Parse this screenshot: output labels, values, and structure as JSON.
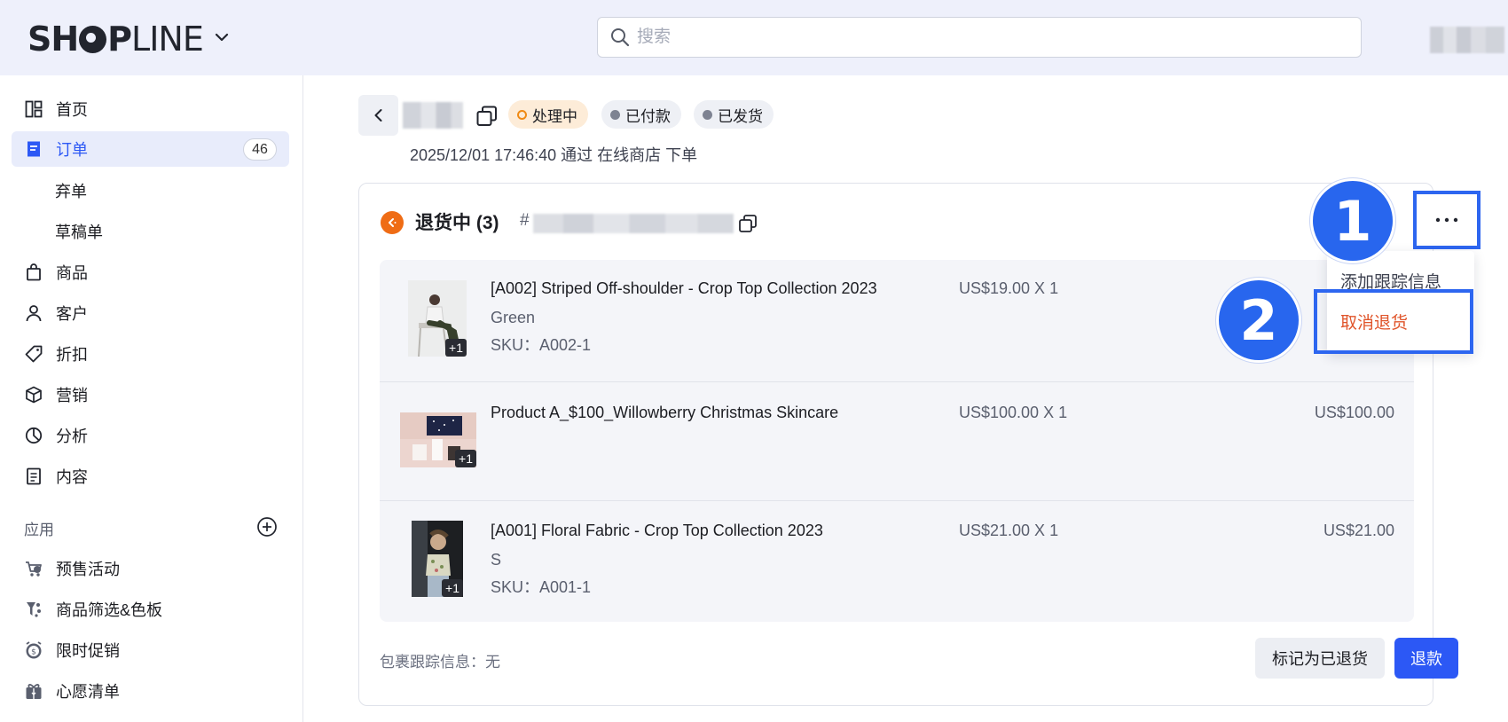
{
  "header": {
    "logo_text_1": "SH",
    "logo_text_2": "P",
    "logo_text_3": "LINE",
    "search_placeholder": "搜索"
  },
  "sidebar": {
    "items": [
      {
        "label": "首页",
        "icon": "dashboard-icon"
      },
      {
        "label": "订单",
        "icon": "orders-icon",
        "badge": "46",
        "active": true
      },
      {
        "label": "弃单",
        "sub": true
      },
      {
        "label": "草稿单",
        "sub": true
      },
      {
        "label": "商品",
        "icon": "shopping-bag-icon"
      },
      {
        "label": "客户",
        "icon": "user-icon"
      },
      {
        "label": "折扣",
        "icon": "tag-icon"
      },
      {
        "label": "营销",
        "icon": "box-icon"
      },
      {
        "label": "分析",
        "icon": "pie-chart-icon"
      },
      {
        "label": "内容",
        "icon": "document-icon"
      }
    ],
    "apps_label": "应用",
    "apps": [
      {
        "label": "预售活动",
        "icon": "presale-icon"
      },
      {
        "label": "商品筛选&色板",
        "icon": "filter-icon"
      },
      {
        "label": "限时促销",
        "icon": "timer-icon"
      },
      {
        "label": "心愿清单",
        "icon": "gift-icon"
      }
    ]
  },
  "order": {
    "tags": [
      "处理中",
      "已付款",
      "已发货"
    ],
    "meta": "2025/12/01 17:46:40 通过 在线商店 下单"
  },
  "card": {
    "title": "退货中 (3)",
    "hash_prefix": "#",
    "items": [
      {
        "name": "[A002] Striped Off-shoulder - Crop Top Collection 2023",
        "variant": "Green",
        "sku": "SKU：A002-1",
        "price": "US$19.00 X 1",
        "total": "",
        "plus": "+1"
      },
      {
        "name": "Product A_$100_Willowberry Christmas Skincare",
        "variant": "",
        "sku": "",
        "price": "US$100.00 X 1",
        "total": "US$100.00",
        "plus": "+1"
      },
      {
        "name": "[A001] Floral Fabric - Crop Top Collection 2023",
        "variant": "S",
        "sku": "SKU：A001-1",
        "price": "US$21.00 X 1",
        "total": "US$21.00",
        "plus": "+1"
      }
    ],
    "tracking_info": "包裹跟踪信息：无",
    "mark_returned_label": "标记为已退货",
    "refund_label": "退款"
  },
  "dropdown": {
    "more_label": "···",
    "add_tracking": "添加跟踪信息",
    "cancel_return": "取消退货"
  },
  "steps": {
    "step1": "1",
    "step2": "2"
  },
  "colors": {
    "accent": "#2c58f5",
    "processing": "#f08a14",
    "cancel": "#e0542a",
    "return_icon": "#ef6c15"
  }
}
